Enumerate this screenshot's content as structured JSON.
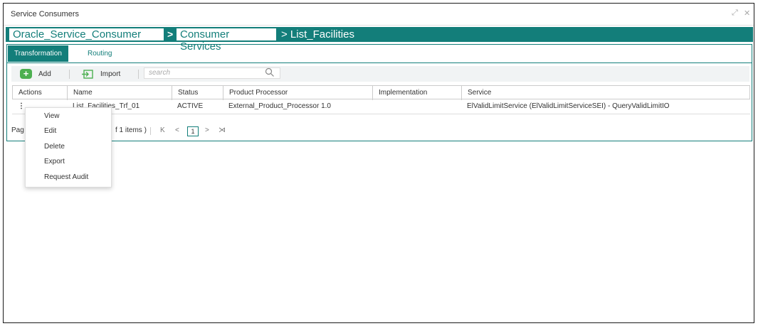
{
  "window": {
    "title": "Service Consumers"
  },
  "breadcrumb": {
    "items": [
      "Oracle_Service_Consumer",
      "Consumer Services"
    ],
    "separator": ">",
    "current": "> List_Facilities"
  },
  "tabs": [
    {
      "label": "Transformation",
      "active": true
    },
    {
      "label": "Routing",
      "active": false
    }
  ],
  "toolbar": {
    "add_label": "Add",
    "import_label": "Import",
    "search_placeholder": "search"
  },
  "table": {
    "columns": [
      "Actions",
      "Name",
      "Status",
      "Product Processor",
      "Implementation",
      "Service"
    ],
    "rows": [
      {
        "actions": "⋮",
        "name": "List_Facilities_Trf_01",
        "status": "ACTIVE",
        "product_processor": "External_Product_Processor 1.0",
        "implementation": "",
        "service": "ElValidLimitService (ElValidLimitServiceSEI) - QueryValidLimitIO"
      }
    ]
  },
  "pager": {
    "label_prefix": "Pag",
    "items_text": "f 1 items )",
    "first": "K",
    "prev": "<",
    "page": "1",
    "next": ">",
    "last": "⋊"
  },
  "context_menu": {
    "items": [
      "View",
      "Edit",
      "Delete",
      "Export",
      "Request Audit"
    ]
  },
  "colors": {
    "accent": "#137e7a",
    "add_green": "#4caf50"
  }
}
